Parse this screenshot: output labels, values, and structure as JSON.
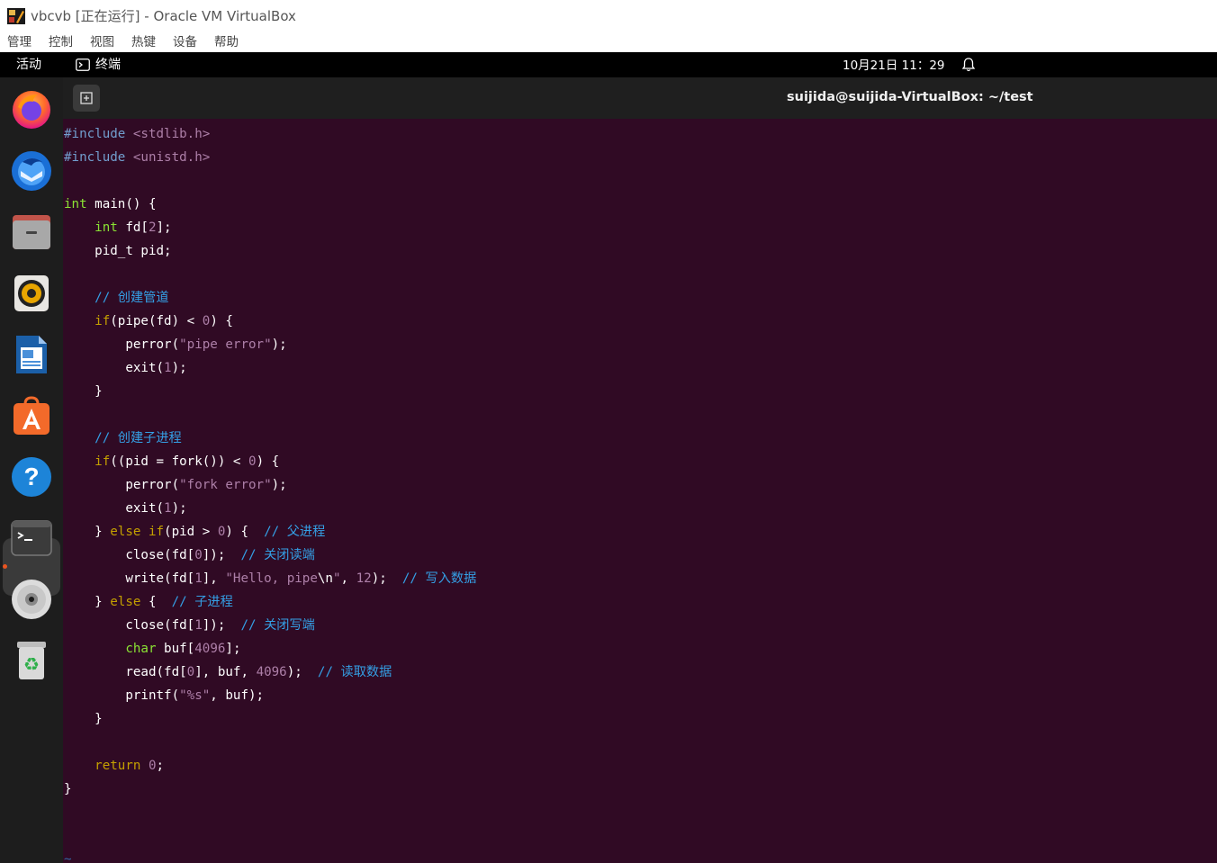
{
  "host": {
    "title": "vbcvb [正在运行] - Oracle VM VirtualBox",
    "menu": [
      "管理",
      "控制",
      "视图",
      "热键",
      "设备",
      "帮助"
    ]
  },
  "topbar": {
    "activities": "活动",
    "app_name": "终端",
    "clock": "10月21日  11：29"
  },
  "dock": {
    "items": [
      "firefox-icon",
      "thunderbird-icon",
      "files-icon",
      "rhythmbox-icon",
      "libreoffice-writer-icon",
      "software-center-icon",
      "help-icon",
      "terminal-icon",
      "optical-disc-icon",
      "trash-icon"
    ],
    "running": "terminal-icon",
    "accent": "#e95420"
  },
  "terminal": {
    "title": "suijida@suijida-VirtualBox: ~/test",
    "background": "#300a24",
    "lines": [
      [
        {
          "t": "#include ",
          "c": "pp"
        },
        {
          "t": "<stdlib.h>",
          "c": "str"
        }
      ],
      [
        {
          "t": "#include ",
          "c": "pp"
        },
        {
          "t": "<unistd.h>",
          "c": "str"
        }
      ],
      [],
      [
        {
          "t": "int",
          "c": "ty"
        },
        {
          "t": " main() {"
        }
      ],
      [
        {
          "t": "    "
        },
        {
          "t": "int",
          "c": "ty"
        },
        {
          "t": " fd["
        },
        {
          "t": "2",
          "c": "num"
        },
        {
          "t": "];"
        }
      ],
      [
        {
          "t": "    pid_t pid;"
        }
      ],
      [],
      [
        {
          "t": "    "
        },
        {
          "t": "// 创建管道",
          "c": "cm"
        }
      ],
      [
        {
          "t": "    "
        },
        {
          "t": "if",
          "c": "kw"
        },
        {
          "t": "(pipe(fd) < "
        },
        {
          "t": "0",
          "c": "num"
        },
        {
          "t": ") {"
        }
      ],
      [
        {
          "t": "        perror("
        },
        {
          "t": "\"pipe error\"",
          "c": "str"
        },
        {
          "t": ");"
        }
      ],
      [
        {
          "t": "        exit("
        },
        {
          "t": "1",
          "c": "num"
        },
        {
          "t": ");"
        }
      ],
      [
        {
          "t": "    }"
        }
      ],
      [],
      [
        {
          "t": "    "
        },
        {
          "t": "// 创建子进程",
          "c": "cm"
        }
      ],
      [
        {
          "t": "    "
        },
        {
          "t": "if",
          "c": "kw"
        },
        {
          "t": "((pid = fork()) < "
        },
        {
          "t": "0",
          "c": "num"
        },
        {
          "t": ") {"
        }
      ],
      [
        {
          "t": "        perror("
        },
        {
          "t": "\"fork error\"",
          "c": "str"
        },
        {
          "t": ");"
        }
      ],
      [
        {
          "t": "        exit("
        },
        {
          "t": "1",
          "c": "num"
        },
        {
          "t": ");"
        }
      ],
      [
        {
          "t": "    } "
        },
        {
          "t": "else if",
          "c": "kw"
        },
        {
          "t": "(pid > "
        },
        {
          "t": "0",
          "c": "num"
        },
        {
          "t": ") {  "
        },
        {
          "t": "// 父进程",
          "c": "cm"
        }
      ],
      [
        {
          "t": "        close(fd["
        },
        {
          "t": "0",
          "c": "num"
        },
        {
          "t": "]);  "
        },
        {
          "t": "// 关闭读端",
          "c": "cm"
        }
      ],
      [
        {
          "t": "        write(fd["
        },
        {
          "t": "1",
          "c": "num"
        },
        {
          "t": "], "
        },
        {
          "t": "\"Hello, pipe",
          "c": "str"
        },
        {
          "t": "\\n"
        },
        {
          "t": "\"",
          "c": "str"
        },
        {
          "t": ", "
        },
        {
          "t": "12",
          "c": "num"
        },
        {
          "t": ");  "
        },
        {
          "t": "// 写入数据",
          "c": "cm"
        }
      ],
      [
        {
          "t": "    } "
        },
        {
          "t": "else",
          "c": "kw"
        },
        {
          "t": " {  "
        },
        {
          "t": "// 子进程",
          "c": "cm"
        }
      ],
      [
        {
          "t": "        close(fd["
        },
        {
          "t": "1",
          "c": "num"
        },
        {
          "t": "]);  "
        },
        {
          "t": "// 关闭写端",
          "c": "cm"
        }
      ],
      [
        {
          "t": "        "
        },
        {
          "t": "char",
          "c": "ty"
        },
        {
          "t": " buf["
        },
        {
          "t": "4096",
          "c": "num"
        },
        {
          "t": "];"
        }
      ],
      [
        {
          "t": "        read(fd["
        },
        {
          "t": "0",
          "c": "num"
        },
        {
          "t": "], buf, "
        },
        {
          "t": "4096",
          "c": "num"
        },
        {
          "t": ");  "
        },
        {
          "t": "// 读取数据",
          "c": "cm"
        }
      ],
      [
        {
          "t": "        printf("
        },
        {
          "t": "\"%s\"",
          "c": "str"
        },
        {
          "t": ", buf);"
        }
      ],
      [
        {
          "t": "    }"
        }
      ],
      [],
      [
        {
          "t": "    "
        },
        {
          "t": "return",
          "c": "kw"
        },
        {
          "t": " "
        },
        {
          "t": "0",
          "c": "num"
        },
        {
          "t": ";"
        }
      ],
      [
        {
          "t": "}"
        }
      ],
      [],
      [],
      [
        {
          "t": "~",
          "c": "tilde"
        }
      ],
      [
        {
          "t": "~",
          "c": "tilde"
        }
      ]
    ]
  }
}
